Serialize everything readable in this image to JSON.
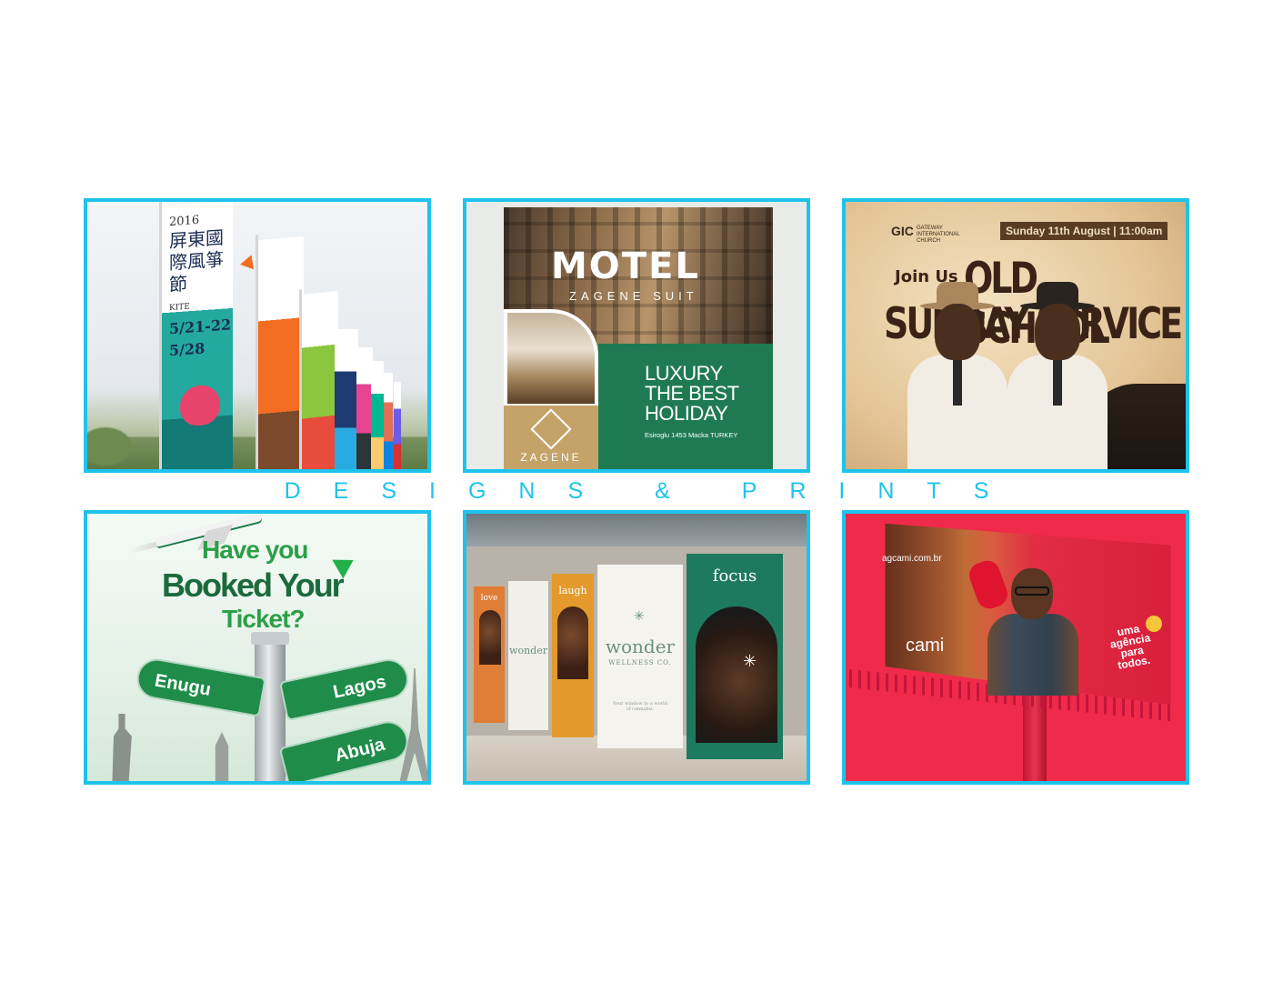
{
  "caption": "DESIGNS & PRINTS",
  "colors": {
    "frame": "#1ec3ec",
    "caption": "#1ec3ec",
    "background": "#ffffff"
  },
  "tiles": [
    {
      "name": "kite-festival-flags",
      "year": "2016",
      "title": "屏東國際風箏節",
      "subtitle": "KITE",
      "date1": "5/21-22",
      "date2": "5/28"
    },
    {
      "name": "motel-zagene",
      "title": "MOTEL",
      "subtitle": "ZAGENE SUIT",
      "headline": "LUXURY THE BEST HOLIDAY",
      "address": "Esiroglu 1453 Macka TURKEY",
      "brand": "ZAGENE"
    },
    {
      "name": "old-school-sunday-service",
      "church_short": "GIC",
      "church_name": "GATEWAY INTERNATIONAL CHURCH",
      "date": "Sunday 11th August | 11:00am",
      "lead": "Join Us",
      "line1": "OLD SCHOOL",
      "line2": "SUNDAY SERVICE"
    },
    {
      "name": "booked-ticket",
      "line1": "Have you",
      "line2": "Booked Your",
      "line3": "Ticket?",
      "sign1": "Enugu",
      "sign2": "Lagos",
      "sign3": "Abuja"
    },
    {
      "name": "wonder-wellness-storefront",
      "panel1": "love",
      "panel2": "laugh",
      "panel3": "focus",
      "brand": "wonder",
      "brand_sub": "WELLNESS CO.",
      "tagline": "Your window to a world of cannabis."
    },
    {
      "name": "cami-billboard",
      "url": "agcami.com.br",
      "logo": "cami",
      "slogan": "uma agência para todos."
    }
  ]
}
